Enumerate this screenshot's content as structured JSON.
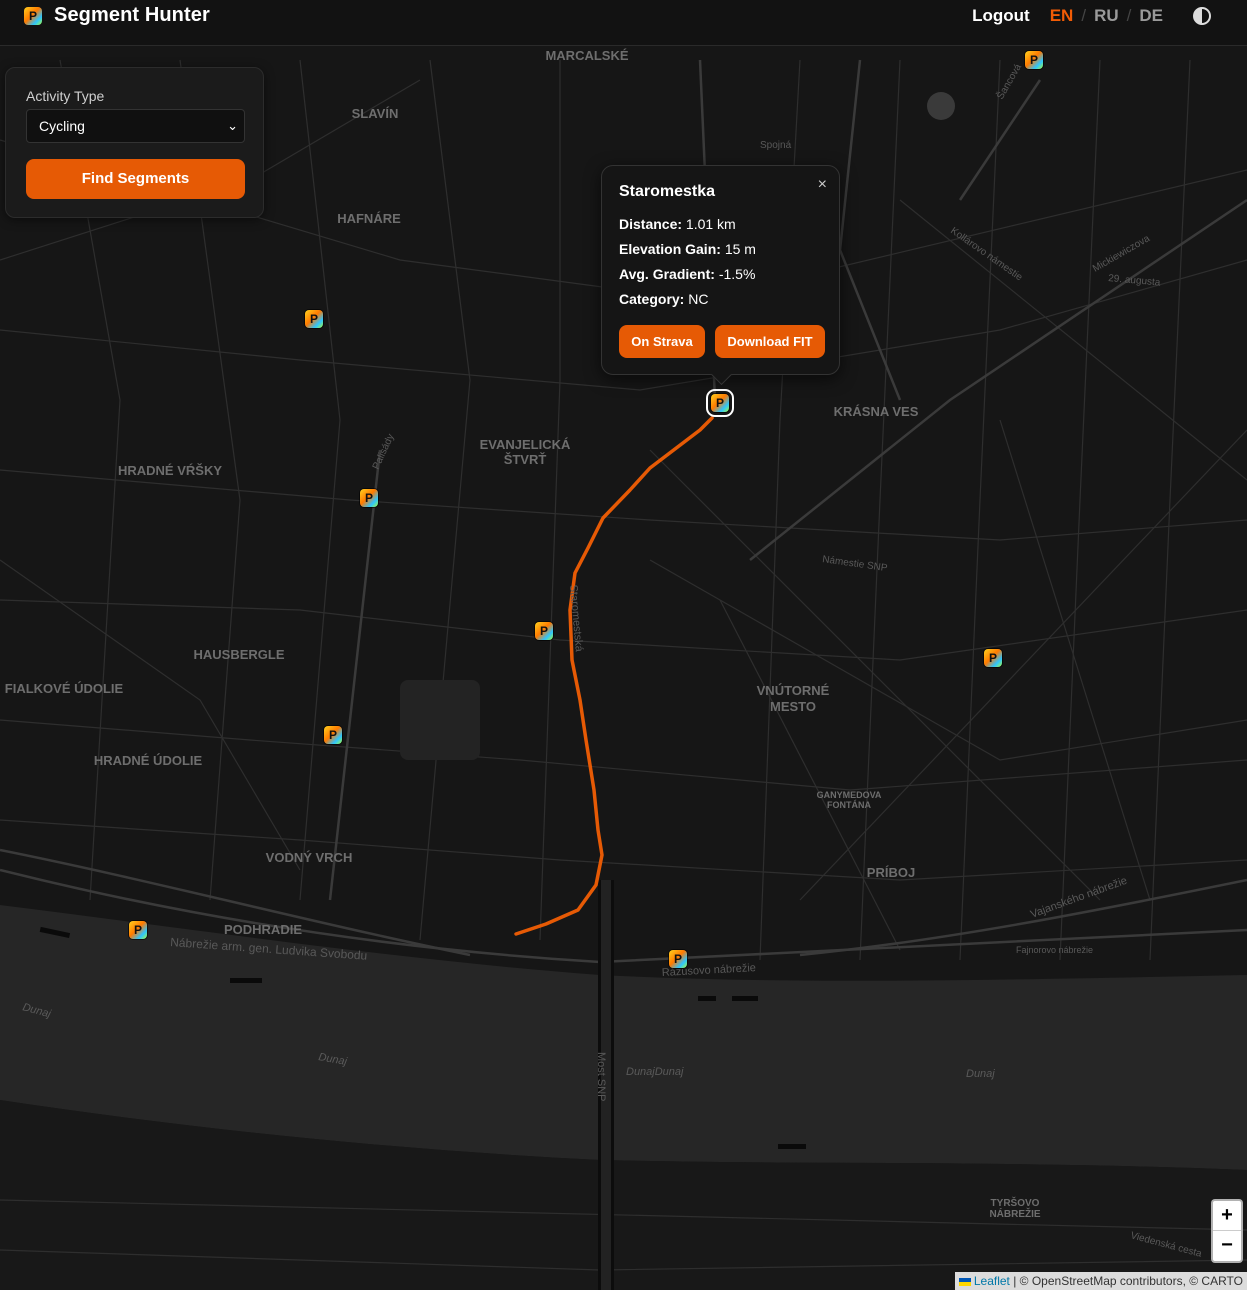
{
  "header": {
    "title": "Segment Hunter",
    "logo_letter": "P",
    "logout": "Logout",
    "languages": [
      {
        "code": "EN",
        "active": true
      },
      {
        "code": "RU",
        "active": false
      },
      {
        "code": "DE",
        "active": false
      }
    ],
    "separator": "/",
    "theme_icon": "half-circle-icon"
  },
  "panel": {
    "activity_label": "Activity Type",
    "activity_value": "Cycling",
    "find_button": "Find Segments"
  },
  "popup": {
    "title": "Staromestka",
    "close": "×",
    "distance_label": "Distance:",
    "distance_value": "1.01 km",
    "elevation_label": "Elevation Gain:",
    "elevation_value": "15 m",
    "gradient_label": "Avg. Gradient:",
    "gradient_value": "-1.5%",
    "category_label": "Category:",
    "category_value": "NC",
    "strava_button": "On Strava",
    "download_button": "Download FIT"
  },
  "map": {
    "marker_letter": "P",
    "route_color": "#e65a05",
    "districts": [
      "MARCALSKÉ",
      "SLAVÍN",
      "HAFNÁRE",
      "KRÁSNA VES",
      "EVANJELICKÁ",
      "ŠTVRŤ",
      "HRADNÉ VŔŠKY",
      "HAUSBERGLE",
      "FIALKOVÉ ÚDOLIE",
      "HRADNÉ ÚDOLIE",
      "VNÚTORNÉ",
      "MESTO",
      "VODNÝ VRCH",
      "PODHRADIE",
      "PRÍBOJ",
      "GANYMEDOVA",
      "FONTÁNA",
      "TYRŠOVO",
      "NÁBREŽIE"
    ],
    "streets": [
      "Nábrežie arm. gen. Ludvika Svobodu",
      "Rázusovo nábrežie",
      "Vajanského nábrežie",
      "Most SNP",
      "Námestie SNP",
      "Kollárovo námestie",
      "29. augusta",
      "Palisády",
      "Staromestská",
      "Fajnorovo nábrežie",
      "Viedenská cesta",
      "Spojná",
      "Šancová",
      "Mickiewiczova"
    ],
    "river_labels": [
      "Dunaj",
      "Dunaj",
      "DunajDunaj",
      "Dunaj"
    ]
  },
  "zoom": {
    "in": "+",
    "out": "−"
  },
  "attribution": {
    "leaflet": "Leaflet",
    "rest": " | © OpenStreetMap contributors, © CARTO"
  }
}
